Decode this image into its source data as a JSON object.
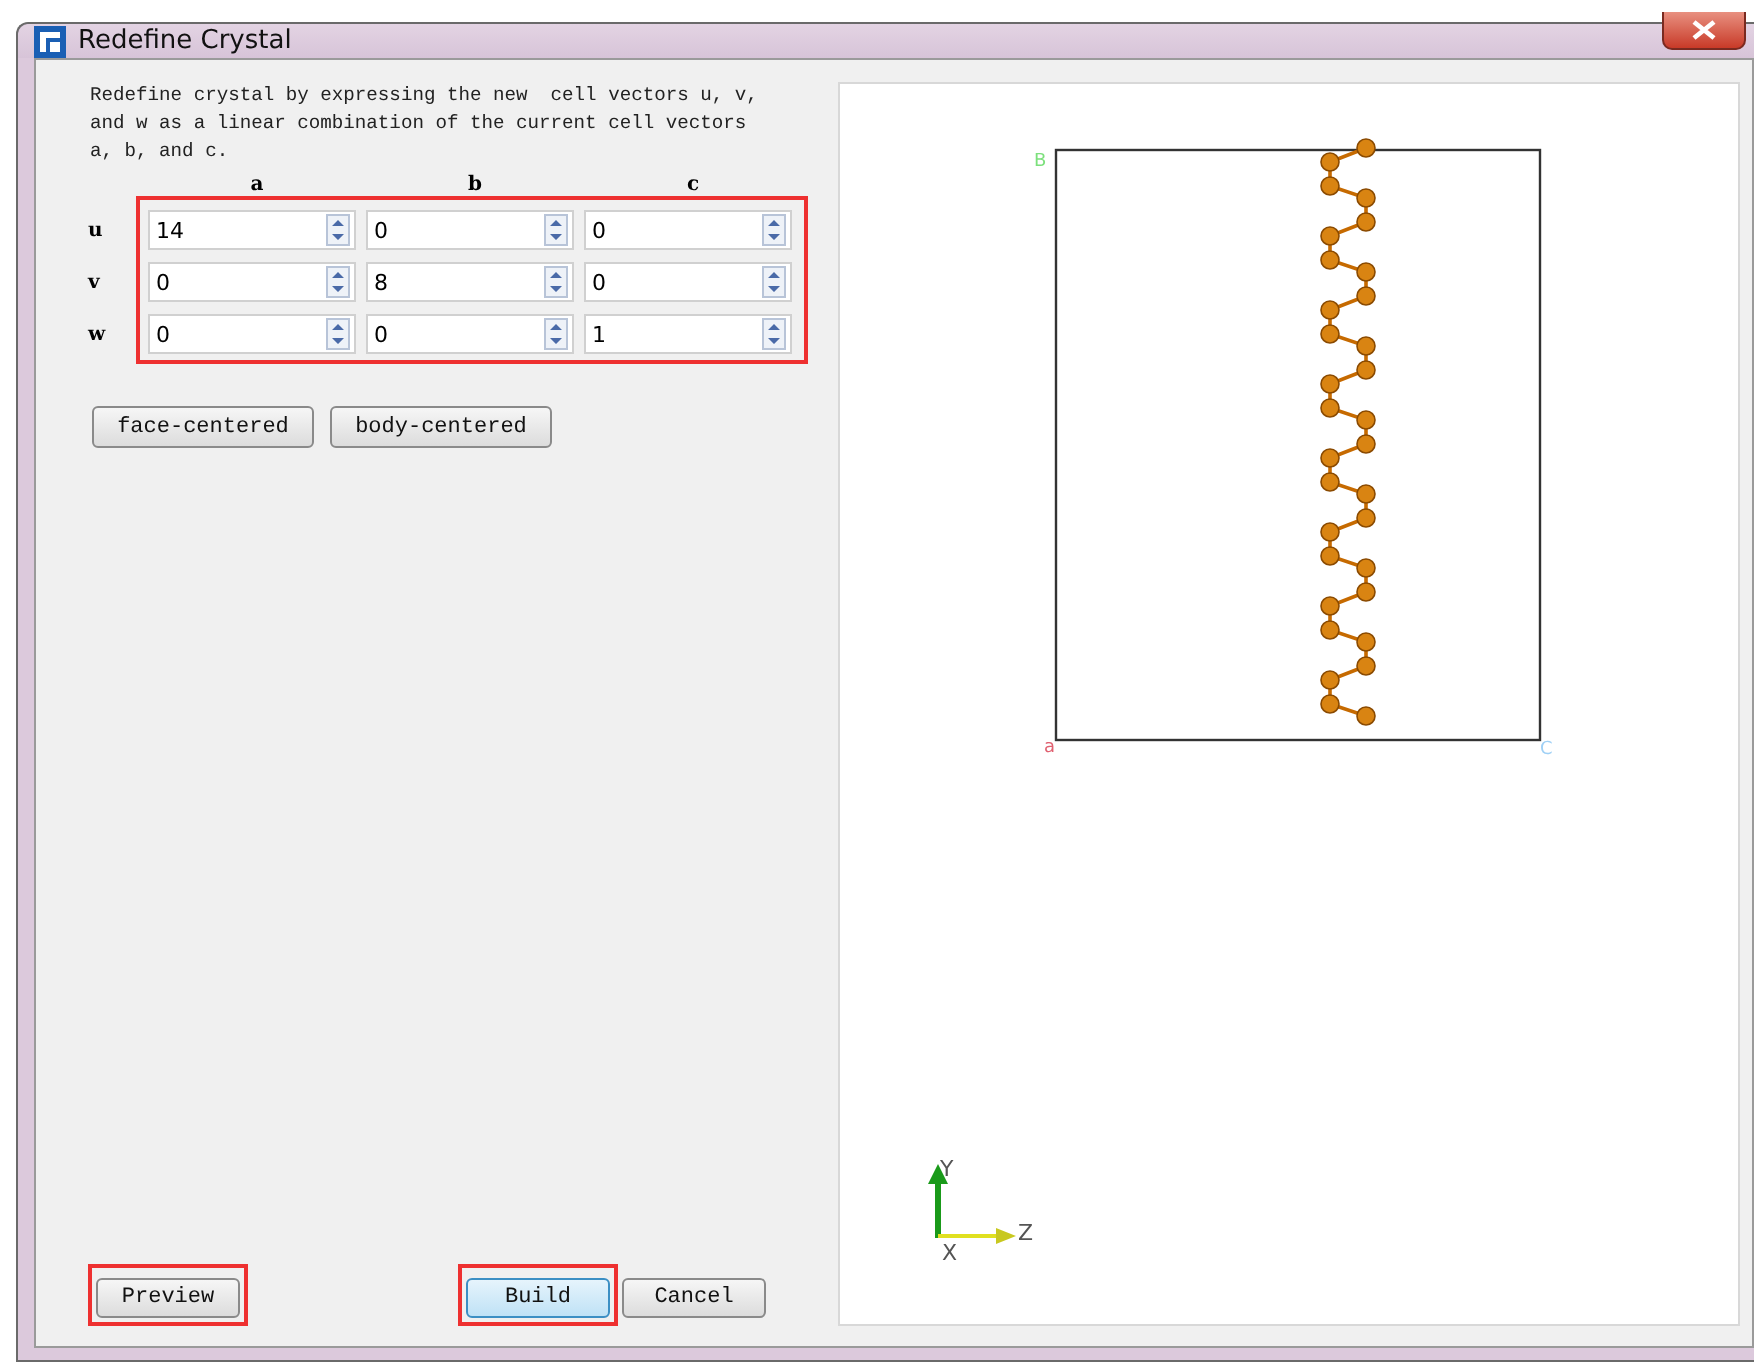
{
  "window": {
    "title": "Redefine Crystal"
  },
  "description": "Redefine crystal by expressing the new  cell vectors u, v, and w as a linear combination of the current cell vectors a, b, and c.",
  "matrix": {
    "highlighted": true,
    "columns": [
      "a",
      "b",
      "c"
    ],
    "rows": [
      {
        "label": "u",
        "values": [
          "14",
          "0",
          "0"
        ]
      },
      {
        "label": "v",
        "values": [
          "0",
          "8",
          "0"
        ]
      },
      {
        "label": "w",
        "values": [
          "0",
          "0",
          "1"
        ]
      }
    ]
  },
  "centering_buttons": [
    "face-centered",
    "body-centered"
  ],
  "viewer": {
    "cell_labels": {
      "b": "B",
      "origin": "a",
      "c": "C"
    },
    "axes": {
      "y": "Y",
      "x": "X",
      "z": "Z"
    }
  },
  "buttons": [
    {
      "label": "Preview",
      "highlighted": true,
      "default": false
    },
    {
      "label": "Build",
      "highlighted": true,
      "default": true
    },
    {
      "label": "Cancel",
      "highlighted": false,
      "default": false
    }
  ]
}
